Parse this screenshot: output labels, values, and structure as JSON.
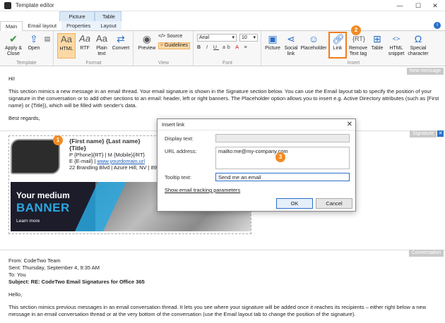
{
  "window": {
    "title": "Template editor",
    "controls": [
      "—",
      "☐",
      "✕"
    ]
  },
  "context_groups": [
    "Picture",
    "Table"
  ],
  "tabs": [
    "Main",
    "Email layout",
    "Properties",
    "Layout"
  ],
  "ribbon": {
    "template": {
      "label": "Template",
      "apply": "Apply & Close",
      "open": "Open"
    },
    "format": {
      "label": "Format",
      "html": "HTML",
      "rtf": "RTF",
      "plain": "Plain text",
      "convert": "Convert"
    },
    "view": {
      "label": "View",
      "preview": "Preview",
      "source": "</> Source",
      "guidelines": "Guidelines"
    },
    "font": {
      "label": "Font",
      "family": "Arial",
      "size": "10"
    },
    "insert": {
      "label": "Insert",
      "picture": "Picture",
      "social": "Social link",
      "placeholder": "Placeholder",
      "link": "Link",
      "remove": "Remove Text tag",
      "table": "Table",
      "snippet": "HTML snippet",
      "special": "Special character"
    }
  },
  "tags": {
    "new_message": "New message",
    "signature": "Signature",
    "conversation": "Conversation"
  },
  "new_message": {
    "greeting": "Hi!",
    "body": "This section mimics a new message in an email thread. Your email signature is shown in the Signature section below. You can use the Email layout tab to specify the position of your signature in the conversation or to add other sections to an email: header, left or right banners. The Placeholder option allows you to insert e.g. Active Directory attributes (such as {First name} or {Title}), which will be filled with sender's data.",
    "closing": "Best regards,"
  },
  "signature": {
    "name": "{First name} {Last name}",
    "title": "{Title}",
    "phone": "P {Phone}{RT} | M {Mobile}{/RT}",
    "email": "E {E-mail} | ",
    "url": "www.yourdomain.url",
    "address": "22 Branding Blvd | Azure Hill, NV | 89404",
    "banner_line1": "Your medium",
    "banner_line2": "BANNER",
    "banner_cta": "Learn more"
  },
  "conversation": {
    "from": "From: CodeTwo Team",
    "sent": "Sent: Thursday, September 4, 9:35 AM",
    "to": "To: You",
    "subject": "Subject: RE: CodeTwo Email Signatures for Office 365",
    "hello": "Hello,",
    "body": "This section mimics previous messages in an email conversation thread. It lets you see where your signature will be added once it reaches its recipients – either right below a new message in an email conversation thread or at the very bottom of the conversation (use the Email layout tab to change the position of the signature)."
  },
  "dialog": {
    "title": "Insert link",
    "display_label": "Display text:",
    "display_value": "",
    "url_label": "URL address:",
    "url_value": "mailto:me@my-company.com",
    "tooltip_label": "Tooltip text:",
    "tooltip_value": "Send me an email",
    "tracking_link": "Show email tracking parameters",
    "ok": "OK",
    "cancel": "Cancel"
  },
  "badges": [
    "1",
    "2",
    "3"
  ],
  "colors": {
    "accent": "#2a6fc9",
    "badge": "#f28b22",
    "highlight": "#f07d1e"
  }
}
